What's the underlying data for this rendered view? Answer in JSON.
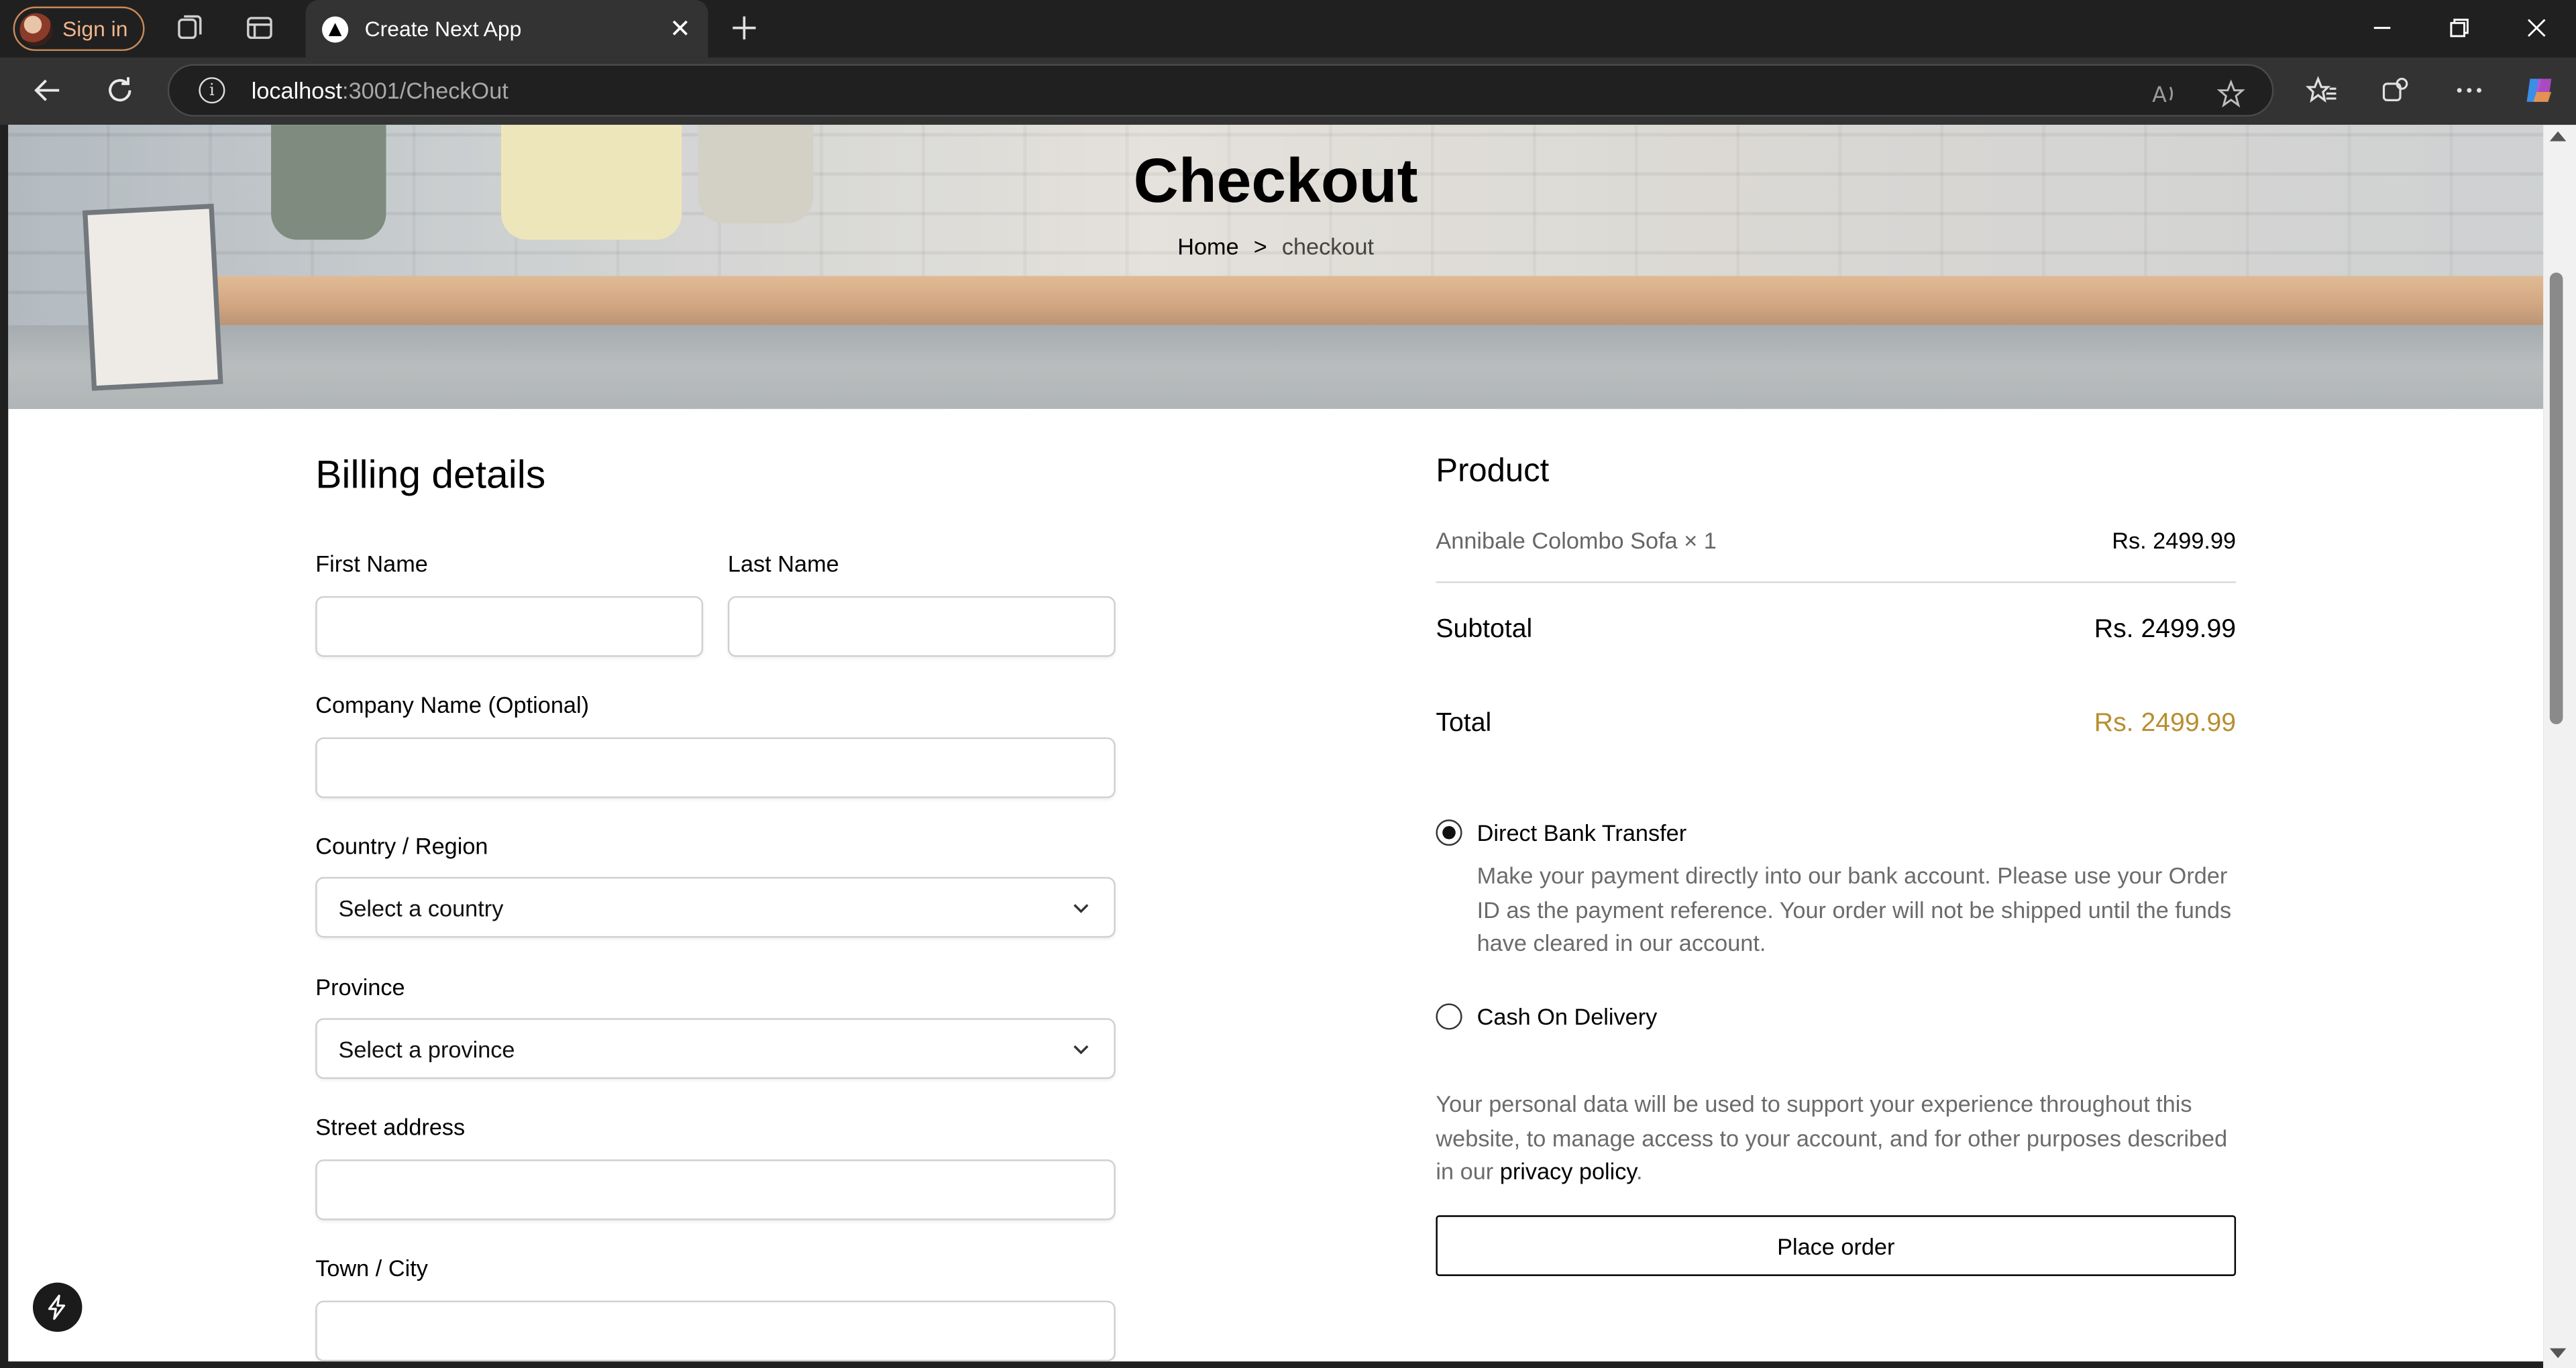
{
  "browser": {
    "signin_label": "Sign in",
    "tab_title": "Create Next App",
    "url_host": "localhost",
    "url_path": ":3001/CheckOut"
  },
  "hero": {
    "title": "Checkout",
    "breadcrumb_home": "Home",
    "breadcrumb_sep": ">",
    "breadcrumb_current": "checkout"
  },
  "billing": {
    "heading": "Billing details",
    "first_name_label": "First Name",
    "last_name_label": "Last Name",
    "company_label": "Company Name (Optional)",
    "country_label": "Country / Region",
    "country_value": "Select a country",
    "province_label": "Province",
    "province_value": "Select a province",
    "street_label": "Street address",
    "town_label": "Town / City"
  },
  "summary": {
    "product_heading": "Product",
    "product_name": "Annibale Colombo Sofa × 1",
    "product_price": "Rs. 2499.99",
    "subtotal_label": "Subtotal",
    "subtotal_value": "Rs. 2499.99",
    "total_label": "Total",
    "total_value": "Rs. 2499.99",
    "total_color": "#b88e2f"
  },
  "payment": {
    "option1_label": "Direct Bank Transfer",
    "option1_desc": "Make your payment directly into our bank account. Please use your Order ID as the payment reference. Your order will not be shipped until the funds have cleared in our account.",
    "option1_selected": true,
    "option2_label": "Cash On Delivery",
    "option2_selected": false
  },
  "privacy": {
    "text": "Your personal data will be used to support your experience throughout this website, to manage access to your account, and for other purposes described in our ",
    "link": "privacy policy",
    "end": "."
  },
  "place_order_label": "Place order"
}
